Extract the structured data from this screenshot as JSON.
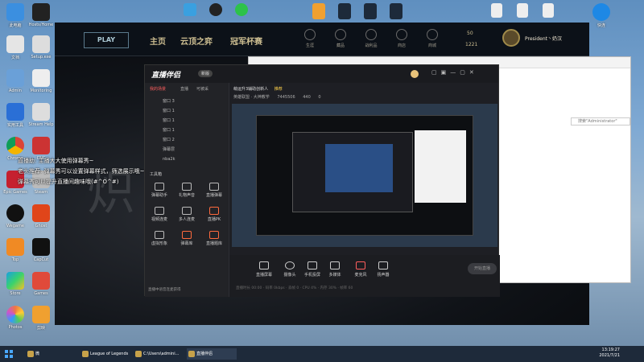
{
  "desktop": {
    "icons": [
      {
        "label": "此电脑"
      },
      {
        "label": "Hosts/Home"
      },
      {
        "label": "文档"
      },
      {
        "label": "Setup.exe"
      },
      {
        "label": "Admin"
      },
      {
        "label": "Monitoring"
      },
      {
        "label": "实用工具"
      },
      {
        "label": "Stream Help"
      },
      {
        "label": "Chrome"
      },
      {
        "label": "CNC"
      },
      {
        "label": "Epic Games"
      },
      {
        "label": "Steam"
      },
      {
        "label": "Wegame"
      },
      {
        "label": "Ghost"
      },
      {
        "label": "Top"
      },
      {
        "label": "CapCut"
      },
      {
        "label": "Store"
      },
      {
        "label": "Games"
      },
      {
        "label": "Photos"
      },
      {
        "label": "剪映"
      }
    ],
    "right_icon_label": "快连"
  },
  "league": {
    "play": "PLAY",
    "nav": [
      "主页",
      "云顶之弈",
      "冠军杯赛"
    ],
    "icons": [
      "生涯",
      "藏品",
      "战利品",
      "商店",
      "商城"
    ],
    "currency_be": "50",
    "currency_rp": "1221",
    "summoner": "President丶奶汉"
  },
  "stream_app": {
    "logo": "直播伴侣",
    "badge": "新版",
    "side_tabs": [
      "我的场景",
      "直播",
      "可被采"
    ],
    "layers": [
      "窗口 3",
      "窗口 1",
      "窗口 1",
      "窗口 1",
      "窗口 2",
      "弹幕层",
      "nba2k"
    ],
    "layer_label": "工具箱",
    "tools": [
      "弹幕助手",
      "礼物声音",
      "直播弹幕",
      "视频连麦",
      "多人连麦",
      "直播PK",
      "虚拟形象",
      "弹幕库",
      "直播题库"
    ],
    "status_bar": "直播中语音连麦获得",
    "header_title": "萌运升3辅助创新人",
    "header_tag": "推荐",
    "header_sub": "英雄联盟 · 大神教学",
    "counters": [
      "7445506",
      "440",
      "0"
    ],
    "bottom_buttons": [
      "直播屏幕",
      "摄像头",
      "手机投屏",
      "多媒体",
      "麦克风",
      "扬声器"
    ],
    "go_live": "开始直播",
    "stats": "直播时长 00:00 · 码率 0kbps · 丢帧 0 · CPU 4% · 内存 30% · 帧率 60"
  },
  "explorer": {
    "search_placeholder": "搜索\"Administrator\""
  },
  "danmaku": [
    "直播助: 主播大大使用弹幕秀~",
    "老头推荐: 弹幕秀可以设置弹幕样式，筛选展示哦~",
    "弹幕秀可以提升直播间趣味哦(#^O^#)"
  ],
  "taskbar": {
    "items": [
      "微",
      "League of Legends",
      "C:\\Users\\admini...",
      "直播伴侣"
    ],
    "time": "13:19:27",
    "date": "2021/7/21"
  }
}
